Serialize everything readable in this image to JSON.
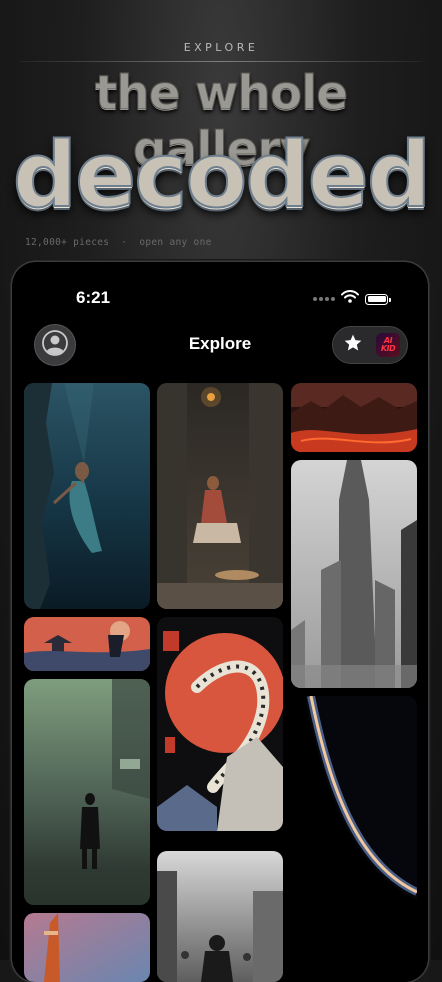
{
  "hero": {
    "eyebrow": "EXPLORE",
    "line1": "the whole gallery",
    "line2": "decoded",
    "tagline": "12,000+ pieces  ·  open any one"
  },
  "status_bar": {
    "time": "6:21",
    "icons": [
      "signal-dots-icon",
      "wifi-icon",
      "battery-icon"
    ]
  },
  "nav": {
    "title": "Explore",
    "left_icon": "profile-icon",
    "right_icons": [
      "star-icon",
      "app-icon"
    ],
    "app_icon_text": "AI\nKID"
  },
  "gallery": {
    "tiles": [
      {
        "name": "underwater-diver"
      },
      {
        "name": "woman-reading-alley"
      },
      {
        "name": "red-fiery-landscape"
      },
      {
        "name": "grey-skyscraper"
      },
      {
        "name": "red-sun-pagoda"
      },
      {
        "name": "red-sun-centipede-monster"
      },
      {
        "name": "foggy-green-street"
      },
      {
        "name": "planet-horizon"
      },
      {
        "name": "foggy-city-crowd"
      },
      {
        "name": "pink-sky-figure"
      }
    ]
  },
  "colors": {
    "background": "#1a1a1a",
    "phone_bg": "#000000",
    "accent_red": "#d8553e"
  }
}
